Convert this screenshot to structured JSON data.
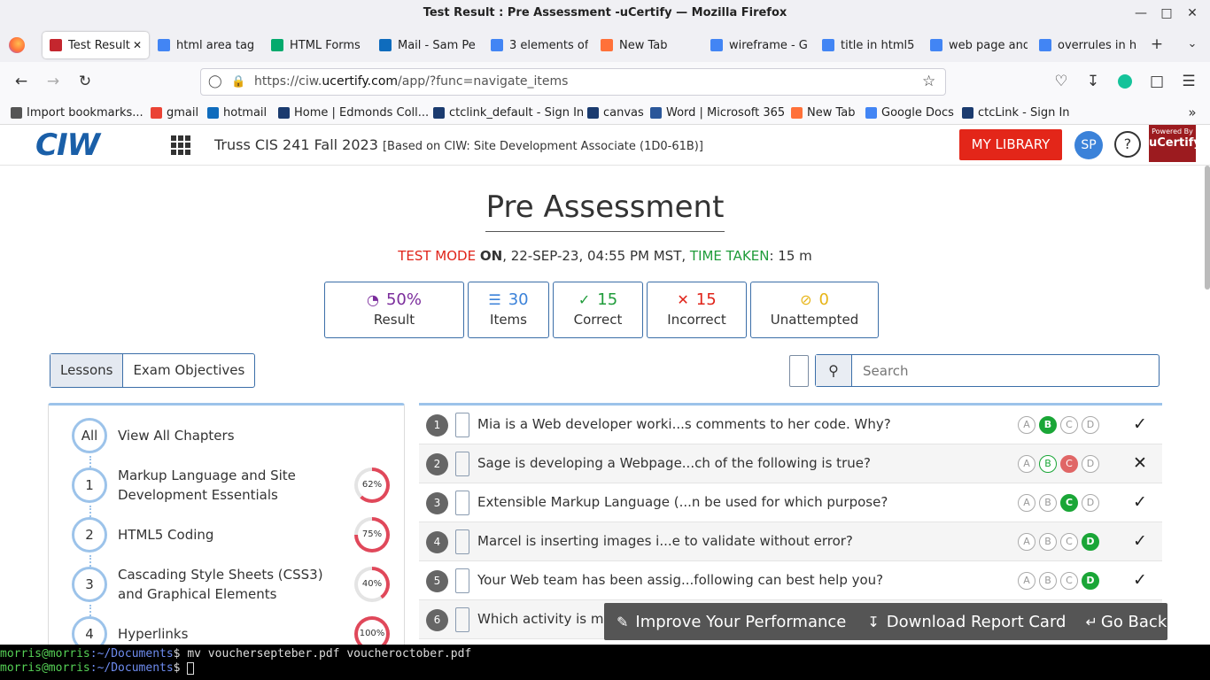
{
  "window": {
    "title": "Test Result : Pre Assessment -uCertify — Mozilla Firefox"
  },
  "tabs": [
    {
      "label": "Test Result",
      "icon": "ucertify-icon",
      "color": "#c4262e"
    },
    {
      "label": "html area tag",
      "icon": "google-icon",
      "color": "#4285f4"
    },
    {
      "label": "HTML Forms",
      "icon": "w3schools-icon",
      "color": "#04aa6d"
    },
    {
      "label": "Mail - Sam Pe",
      "icon": "outlook-icon",
      "color": "#0f6cbd"
    },
    {
      "label": "3 elements of",
      "icon": "google-icon",
      "color": "#4285f4"
    },
    {
      "label": "New Tab",
      "icon": "firefox-icon",
      "color": "#ff7139"
    },
    {
      "label": "wireframe - G",
      "icon": "google-icon",
      "color": "#4285f4"
    },
    {
      "label": "title in html5",
      "icon": "google-icon",
      "color": "#4285f4"
    },
    {
      "label": "web page and",
      "icon": "google-icon",
      "color": "#4285f4"
    },
    {
      "label": "overrules in h",
      "icon": "google-icon",
      "color": "#4285f4"
    }
  ],
  "url": {
    "prefix": "https://ciw.",
    "domain": "ucertify.com",
    "path": "/app/?func=navigate_items"
  },
  "bookmarks": [
    {
      "label": "Import bookmarks...",
      "color": "#555555"
    },
    {
      "label": "gmail",
      "color": "#ea4335"
    },
    {
      "label": "hotmail",
      "color": "#0f6cbd"
    },
    {
      "label": "Home | Edmonds Coll...",
      "color": "#1b3b6f"
    },
    {
      "label": "ctclink_default - Sign In",
      "color": "#1b3b6f"
    },
    {
      "label": "canvas",
      "color": "#1b3b6f"
    },
    {
      "label": "Word | Microsoft 365",
      "color": "#2b579a"
    },
    {
      "label": "New Tab",
      "color": "#ff7139"
    },
    {
      "label": "Google Docs",
      "color": "#4285f4"
    },
    {
      "label": "ctcLink - Sign In",
      "color": "#1b3b6f"
    }
  ],
  "header": {
    "logo": "CIW",
    "course": "Truss CIS 241 Fall 2023",
    "course_sub": "[Based on CIW: Site Development Associate (1D0-61B)]",
    "my_library": "MY LIBRARY",
    "avatar": "SP",
    "help": "?",
    "powered_small": "Powered By",
    "powered_brand": "uCertify"
  },
  "page": {
    "title": "Pre Assessment",
    "mode_label": "TEST MODE",
    "mode_value": "ON",
    "date": ", 22-SEP-23, 04:55 PM MST,",
    "time_label": "TIME TAKEN",
    "time_value": ": 15 m"
  },
  "stats": [
    {
      "value": "50%",
      "label": "Result",
      "color": "#7b2d9c",
      "icon": "gauge-icon"
    },
    {
      "value": "30",
      "label": "Items",
      "color": "#3b82d9",
      "icon": "list-icon"
    },
    {
      "value": "15",
      "label": "Correct",
      "color": "#1f9c3a",
      "icon": "check-icon"
    },
    {
      "value": "15",
      "label": "Incorrect",
      "color": "#e0241a",
      "icon": "x-icon"
    },
    {
      "value": "0",
      "label": "Unattempted",
      "color": "#e7b416",
      "icon": "eye-slash-icon"
    }
  ],
  "lesson_tabs": {
    "lessons": "Lessons",
    "objectives": "Exam Objectives"
  },
  "search": {
    "placeholder": "Search"
  },
  "chapters": [
    {
      "num": "All",
      "title": "View All Chapters",
      "pct": null
    },
    {
      "num": "1",
      "title": "Markup Language and Site Development Essentials",
      "pct": 62
    },
    {
      "num": "2",
      "title": "HTML5 Coding",
      "pct": 75
    },
    {
      "num": "3",
      "title": "Cascading Style Sheets (CSS3) and Graphical Elements",
      "pct": 40
    },
    {
      "num": "4",
      "title": "Hyperlinks",
      "pct": 100
    }
  ],
  "questions": [
    {
      "num": "1",
      "text": "Mia is a Web developer worki...s comments to her code. Why?",
      "opts": [
        "",
        "g",
        "",
        ""
      ],
      "result": "correct"
    },
    {
      "num": "2",
      "text": "Sage is developing a Webpage...ch of the following is true?",
      "opts": [
        "",
        "go",
        "r",
        ""
      ],
      "result": "incorrect"
    },
    {
      "num": "3",
      "text": "Extensible Markup Language (...n be used for which purpose?",
      "opts": [
        "",
        "",
        "g",
        ""
      ],
      "result": "correct"
    },
    {
      "num": "4",
      "text": "Marcel is inserting images i...e to validate without error?",
      "opts": [
        "",
        "",
        "",
        "g"
      ],
      "result": "correct"
    },
    {
      "num": "5",
      "text": "Your Web team has been assig...following can best help you?",
      "opts": [
        "",
        "",
        "",
        "g"
      ],
      "result": "correct"
    },
    {
      "num": "6",
      "text": "Which activity is mos",
      "opts": null,
      "result": null
    }
  ],
  "floatbar": {
    "improve": "Improve Your Performance",
    "download": "Download Report Card",
    "back": "Go Back"
  },
  "terminal": {
    "user": "morris@morris",
    "path": ":~/Documents",
    "cmd": "$ mv vouchersepteber.pdf voucheroctober.pdf",
    "prompt": "$ "
  }
}
